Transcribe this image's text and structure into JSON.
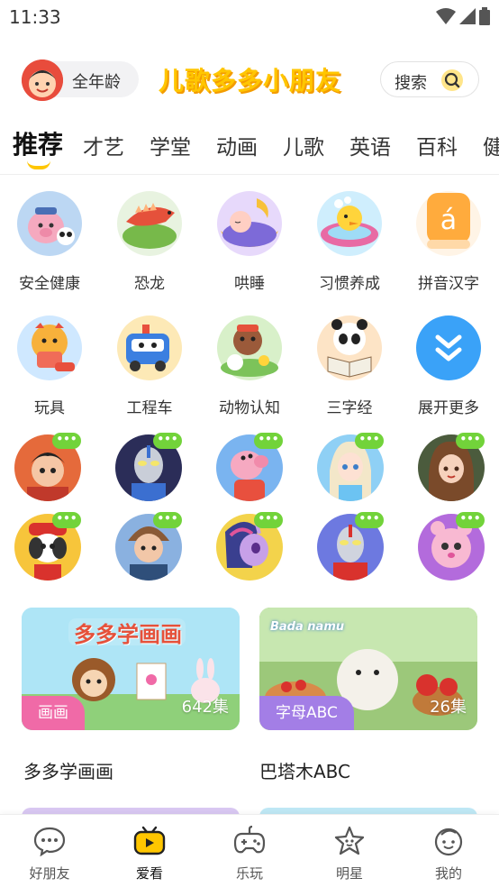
{
  "status_bar": {
    "time": "11:33"
  },
  "header": {
    "age_label": "全年龄",
    "brand": "儿歌多多小朋友",
    "search_label": "搜索"
  },
  "tabs": [
    "推荐",
    "才艺",
    "学堂",
    "动画",
    "儿歌",
    "英语",
    "百科",
    "健"
  ],
  "categories_row1": [
    {
      "label": "安全健康",
      "icon": "safety-pig-icon",
      "color": "#bcd7f3"
    },
    {
      "label": "恐龙",
      "icon": "dinosaur-icon",
      "color": "#e8f3e0"
    },
    {
      "label": "哄睡",
      "icon": "sleep-moon-icon",
      "color": "#e7d9fb"
    },
    {
      "label": "习惯养成",
      "icon": "bath-duck-icon",
      "color": "#cfeefd"
    },
    {
      "label": "拼音汉字",
      "icon": "pinyin-icon",
      "color": "#ffab3d"
    }
  ],
  "categories_row2": [
    {
      "label": "玩具",
      "icon": "toy-tiger-icon",
      "color": "#cfe8ff"
    },
    {
      "label": "工程车",
      "icon": "truck-icon",
      "color": "#fde9b6"
    },
    {
      "label": "动物认知",
      "icon": "animals-icon",
      "color": "#d8f0c9"
    },
    {
      "label": "三字经",
      "icon": "panda-book-icon",
      "color": "#fde4c6"
    },
    {
      "label": "展开更多",
      "icon": "expand-more-icon",
      "color": "#3aa2f8"
    }
  ],
  "characters_row1": [
    {
      "name": "hero-boy-character",
      "color": "#e56a3b"
    },
    {
      "name": "ultraman-blue-character",
      "color": "#2b2d58"
    },
    {
      "name": "pig-character",
      "color": "#7ab4f0"
    },
    {
      "name": "ice-princess-character",
      "color": "#8fd0f5"
    },
    {
      "name": "girl-character",
      "color": "#4b5b3d"
    }
  ],
  "characters_row2": [
    {
      "name": "rescue-puppy-character",
      "color": "#f7c53b"
    },
    {
      "name": "bear-boy-character",
      "color": "#8ab1e0"
    },
    {
      "name": "pony-character",
      "color": "#f3d34b"
    },
    {
      "name": "ultraman-red-character",
      "color": "#6d79e0"
    },
    {
      "name": "pink-pet-character",
      "color": "#b36bdc"
    }
  ],
  "bubble_text": "•••",
  "cards": [
    {
      "tag": "画画",
      "episodes": "642集",
      "title": "多多学画画",
      "banner": "多多学画画",
      "tag_color": "#f06aa7",
      "bg": "#aee5f6"
    },
    {
      "tag": "字母ABC",
      "episodes": "26集",
      "title": "巴塔木ABC",
      "banner": "Bada namu",
      "tag_color": "#a37ee6",
      "bg": "#c9e3a7"
    }
  ],
  "bottom_nav": [
    {
      "label": "好朋友",
      "icon": "chat-bubble-icon",
      "active": false
    },
    {
      "label": "爱看",
      "icon": "tv-icon",
      "active": true
    },
    {
      "label": "乐玩",
      "icon": "gamepad-icon",
      "active": false
    },
    {
      "label": "明星",
      "icon": "star-face-icon",
      "active": false
    },
    {
      "label": "我的",
      "icon": "kid-face-icon",
      "active": false
    }
  ],
  "colors": {
    "accent": "#ffc600",
    "bubble": "#72d33a"
  }
}
